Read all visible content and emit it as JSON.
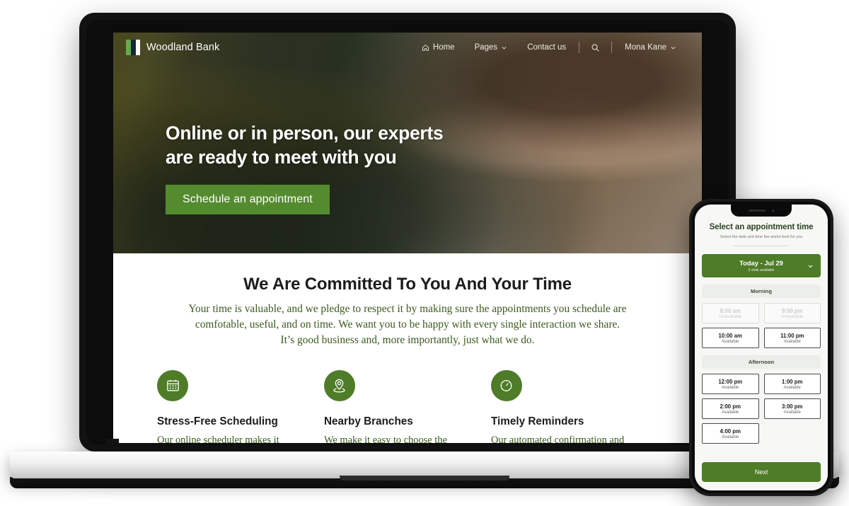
{
  "brand": {
    "name": "Woodland Bank",
    "logo_icon": "woodland-flag-logo",
    "colors": {
      "green": "#4e7c28",
      "cta_green": "#558b2f",
      "navy": "#1b2a3a",
      "text_green": "#3a5a1e"
    }
  },
  "nav": {
    "items": [
      {
        "label": "Home",
        "icon": "home-icon",
        "has_chevron": false
      },
      {
        "label": "Pages",
        "icon": "",
        "has_chevron": true
      },
      {
        "label": "Contact us",
        "icon": "",
        "has_chevron": false
      }
    ],
    "search_icon": "search-icon",
    "account": {
      "label": "Mona Kane",
      "icon": "chevron-down-icon"
    }
  },
  "hero": {
    "title_line1": "Online or in person, our experts",
    "title_line2": "are ready to meet with you",
    "cta_label": "Schedule an appointment"
  },
  "section": {
    "heading": "We Are Committed To You And Your Time",
    "body": "Your time is valuable, and we pledge to respect it by making sure the appointments you schedule are comfotable, useful, and on time. We want you to be happy with every single interaction we share. It’s good business and, more importantly, just what we do."
  },
  "features": [
    {
      "icon": "calendar-icon",
      "title": "Stress-Free Scheduling",
      "text": "Our online scheduler makes it easy to get the meeting time"
    },
    {
      "icon": "location-pin-icon",
      "title": "Nearby Branches",
      "text": "We make it easy to choose the location to meet that is"
    },
    {
      "icon": "clock-icon",
      "title": "Timely Reminders",
      "text": "Our automated confirmation and reminder messages helps"
    }
  ],
  "phone": {
    "title": "Select an appointment time",
    "subtitle": "Select the date and time the works best for you",
    "date_selector": {
      "label": "Today - Jul 29",
      "sub": "3 slots available",
      "icon": "chevron-down-icon"
    },
    "groups": [
      {
        "label": "Morning",
        "slots": [
          {
            "time": "8:00 am",
            "status": "Unavailable",
            "available": false
          },
          {
            "time": "9:00 pm",
            "status": "Unavailable",
            "available": false
          },
          {
            "time": "10:00 am",
            "status": "Available",
            "available": true
          },
          {
            "time": "11:00 pm",
            "status": "Available",
            "available": true
          }
        ]
      },
      {
        "label": "Afternoon",
        "slots": [
          {
            "time": "12:00 pm",
            "status": "Available",
            "available": true
          },
          {
            "time": "1:00 pm",
            "status": "Available",
            "available": true
          },
          {
            "time": "2:00 pm",
            "status": "Available",
            "available": true
          },
          {
            "time": "3:00 pm",
            "status": "Available",
            "available": true
          },
          {
            "time": "4:00 pm",
            "status": "Available",
            "available": true
          }
        ]
      }
    ],
    "next_label": "Next"
  }
}
